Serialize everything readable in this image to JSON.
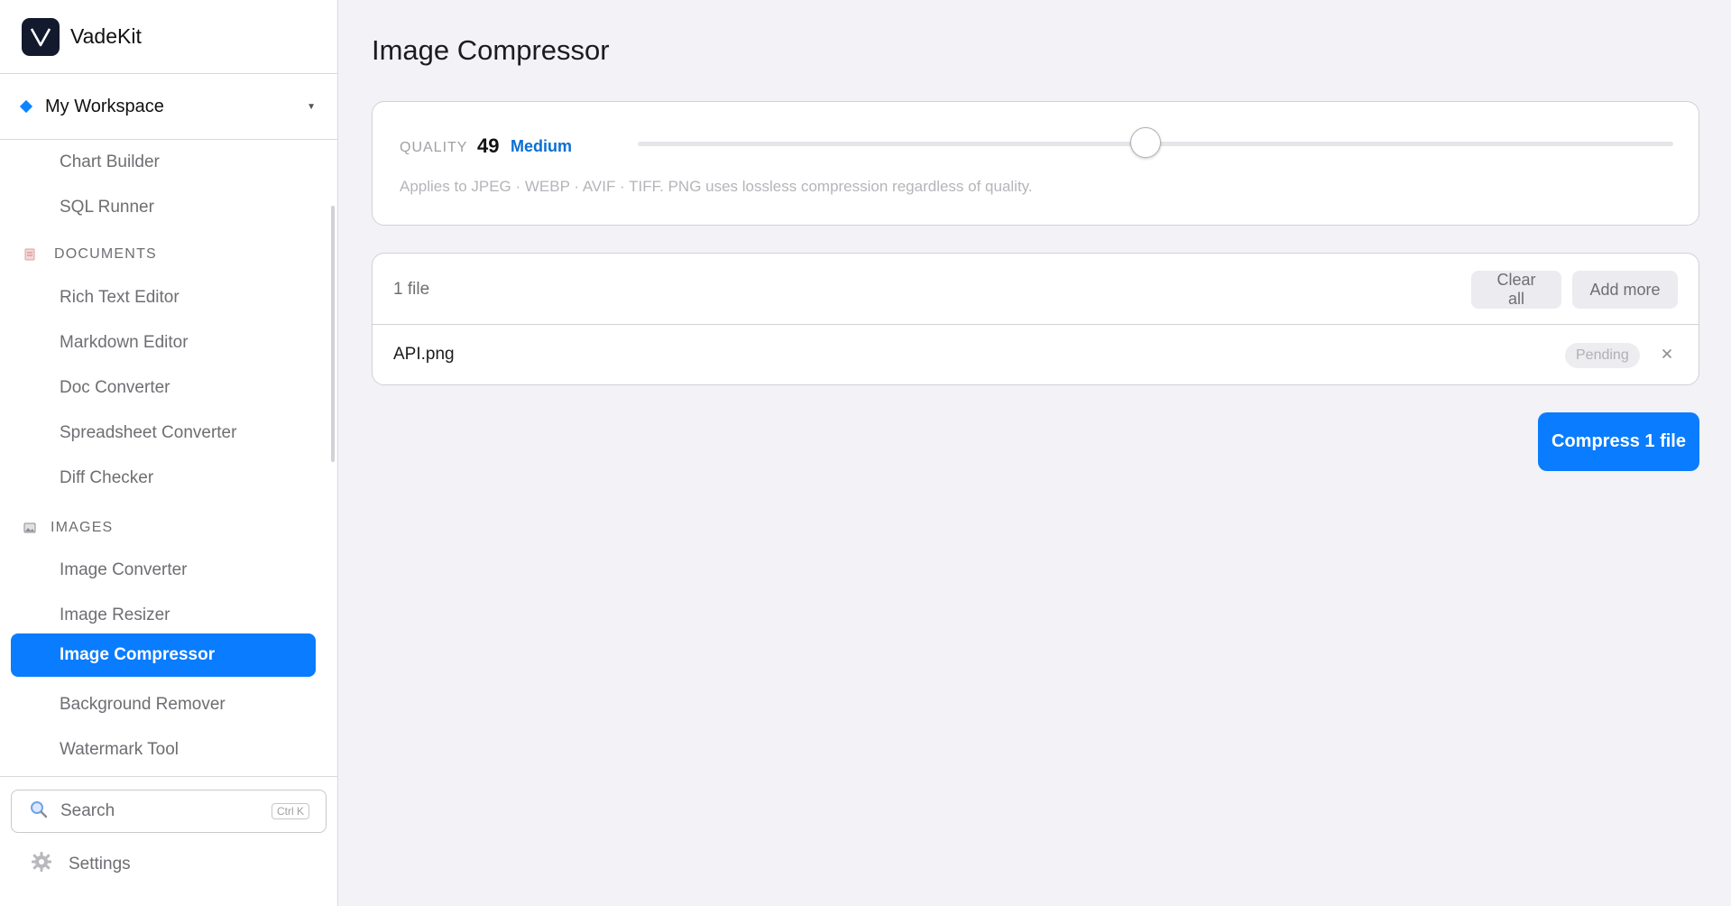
{
  "brand": {
    "name": "VadeKit"
  },
  "workspace": {
    "name": "My Workspace"
  },
  "nav": {
    "top_items": [
      "Chart Builder",
      "SQL Runner"
    ],
    "sections": [
      {
        "title": "DOCUMENTS",
        "icon": "document-icon",
        "items": [
          "Rich Text Editor",
          "Markdown Editor",
          "Doc Converter",
          "Spreadsheet Converter",
          "Diff Checker"
        ]
      },
      {
        "title": "IMAGES",
        "icon": "image-icon",
        "items": [
          "Image Converter",
          "Image Resizer",
          "Image Compressor",
          "Background Remover",
          "Watermark Tool"
        ]
      }
    ],
    "active": "Image Compressor"
  },
  "search": {
    "label": "Search",
    "shortcut": "Ctrl K"
  },
  "settings": {
    "label": "Settings"
  },
  "page": {
    "title": "Image Compressor"
  },
  "quality": {
    "label": "QUALITY",
    "value": "49",
    "level": "Medium",
    "slider_fraction": 0.49,
    "note": "Applies to JPEG · WEBP · AVIF · TIFF. PNG uses lossless compression regardless of quality."
  },
  "files": {
    "count_label": "1 file",
    "clear_label": "Clear all",
    "add_label": "Add more",
    "items": [
      {
        "name": "API.png",
        "status": "Pending"
      }
    ]
  },
  "compress": {
    "label": "Compress 1 file"
  },
  "colors": {
    "accent": "#0a7cff",
    "level": "#0a6fd4",
    "background": "#f2f2f7"
  }
}
